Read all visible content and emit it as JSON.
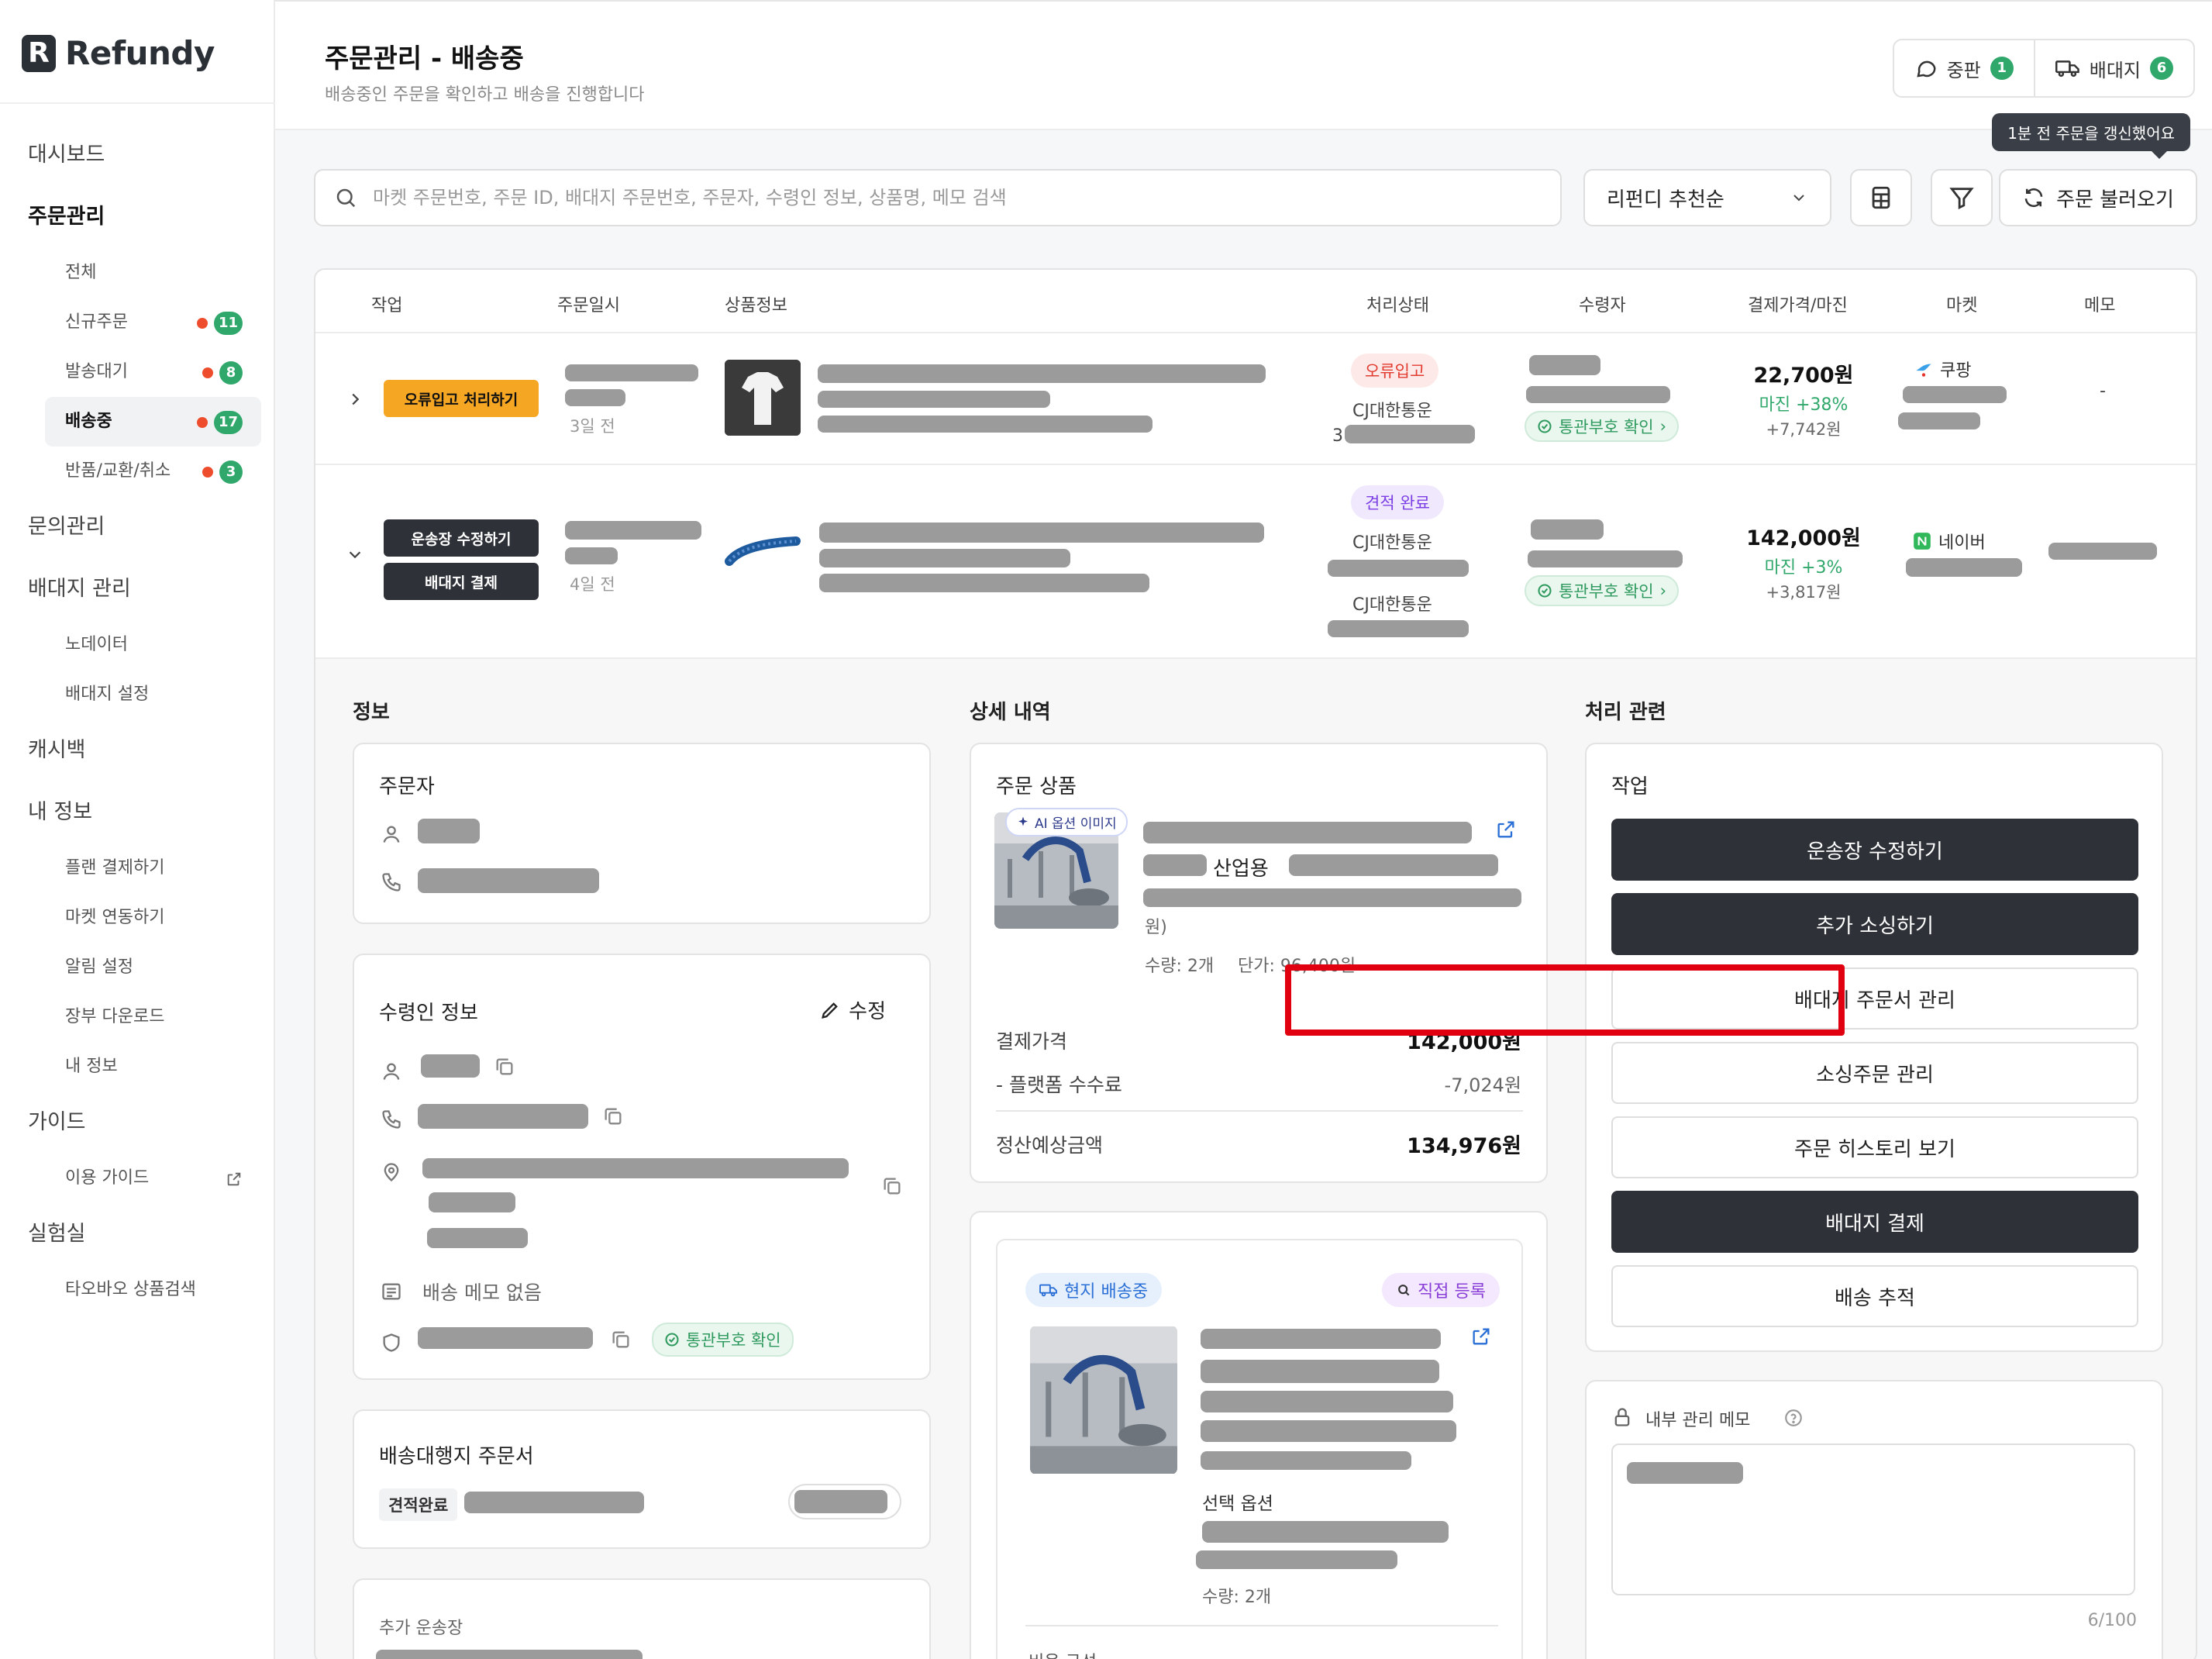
{
  "brand": {
    "name": "Refundy",
    "mark": "R"
  },
  "sidebar": {
    "dashboard": "대시보드",
    "orders": "주문관리",
    "orders_sub": [
      {
        "label": "전체"
      },
      {
        "label": "신규주문",
        "count": "11"
      },
      {
        "label": "발송대기",
        "count": "8"
      },
      {
        "label": "배송중",
        "count": "17"
      },
      {
        "label": "반품/교환/취소",
        "count": "3"
      }
    ],
    "inquiry": "문의관리",
    "forwarder": "배대지 관리",
    "forwarder_sub": [
      "노데이터",
      "배대지 설정"
    ],
    "cashback": "캐시백",
    "myinfo": "내 정보",
    "myinfo_sub": [
      "플랜 결제하기",
      "마켓 연동하기",
      "알림 설정",
      "장부 다운로드",
      "내 정보"
    ],
    "guide": "가이드",
    "guide_sub": [
      "이용 가이드"
    ],
    "lab": "실험실",
    "lab_sub": [
      "타오바오 상품검색"
    ]
  },
  "header": {
    "title": "주문관리 - 배송중",
    "subtitle": "배송중인 주문을 확인하고 배송을 진행합니다",
    "btn_dispute": "중판",
    "btn_dispute_count": "1",
    "btn_forwarder": "배대지",
    "btn_forwarder_count": "6",
    "tooltip": "1분 전 주문을 갱신했어요"
  },
  "search": {
    "placeholder": "마켓 주문번호, 주문 ID, 배대지 주문번호, 주문자, 수령인 정보, 상품명, 메모 검색",
    "select_value": "리펀디 추천순",
    "refresh_label": "주문 불러오기"
  },
  "table": {
    "columns": [
      "작업",
      "주문일시",
      "상품정보",
      "처리상태",
      "수령자",
      "결제가격/마진",
      "마켓",
      "메모"
    ],
    "rows": [
      {
        "action": "오류입고 처리하기",
        "ago": "3일 전",
        "status": "오류입고",
        "courier": "CJ대한통운",
        "tracking_prefix": "3",
        "customs": "통관부호 확인",
        "price": "22,700원",
        "margin": "마진 +38%",
        "profit": "+7,742원",
        "market": "쿠팡",
        "memo": "-"
      },
      {
        "action1": "운송장 수정하기",
        "action2": "배대지 결제",
        "ago": "4일 전",
        "status": "견적 완료",
        "courier": "CJ대한통운",
        "courier2": "CJ대한통운",
        "customs": "통관부호 확인",
        "price": "142,000원",
        "margin": "마진 +3%",
        "profit": "+3,817원",
        "market": "네이버"
      }
    ]
  },
  "detail": {
    "info_title": "정보",
    "orderer_title": "주문자",
    "receiver_title": "수령인 정보",
    "edit_label": "수정",
    "no_memo": "배송 메모 없음",
    "customs": "통관부호 확인",
    "agent_title": "배송대행지 주문서",
    "agent_status": "견적완료",
    "extra_title": "추가 운송장",
    "detail_title": "상세 내역",
    "ordered_product": "주문 상품",
    "ai_badge": "AI 옵션 이미지",
    "product_name_part": "산업용",
    "product_tail": "원)",
    "qty": "수량: 2개",
    "unit_price": "단가: 96,400원",
    "pay_label": "결제가격",
    "pay_value": "142,000원",
    "fee_label": "- 플랫폼 수수료",
    "fee_value": "-7,024원",
    "settle_label": "정산예상금액",
    "settle_value": "134,976원",
    "local_badge": "현지 배송중",
    "direct_badge": "직접 등록",
    "option_label": "선택 옵션",
    "qty2": "수량: 2개",
    "cost_label": "비용 구성",
    "process_title": "처리 관련",
    "work_title": "작업",
    "buttons": [
      "운송장 수정하기",
      "추가 소싱하기",
      "배대지 주문서 관리",
      "소싱주문 관리",
      "주문 히스토리 보기",
      "배대지 결제",
      "배송 추적"
    ],
    "memo_title": "내부 관리 메모",
    "memo_count": "6/100"
  },
  "colors": {
    "accent_dark": "#2e3137",
    "green": "#30a86b",
    "orange": "#f5a623",
    "highlight": "#e0000f"
  }
}
